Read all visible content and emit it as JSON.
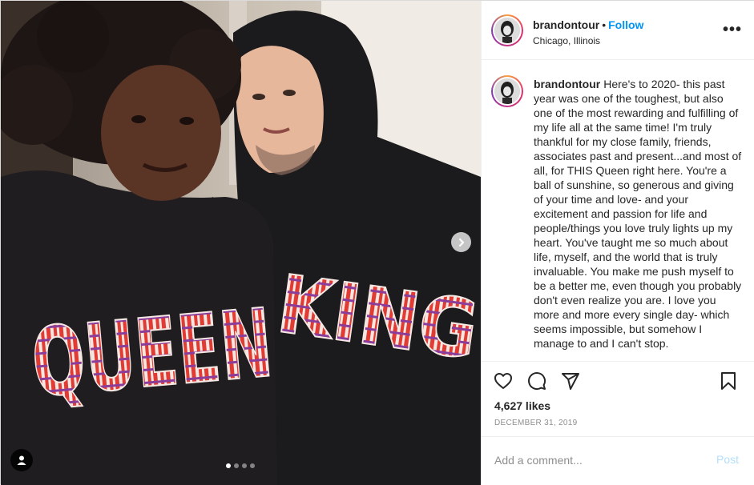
{
  "post": {
    "username": "brandontour",
    "separator": "•",
    "follow_label": "Follow",
    "location": "Chicago, Illinois",
    "more_label": "•••",
    "caption_user": "brandontour",
    "caption_text": "Here's to 2020- this past year was one of the toughest, but also one of the most rewarding and fulfilling of my life all at the same time! I'm truly thankful for my close family, friends, associates past and present...and most of all, for THIS Queen right here. You're a ball of sunshine, so generous and giving of your time and love- and your excitement and passion for life and people/things you love truly lights up my heart. You've taught me so much about life, myself, and the world that is truly invaluable. You make me push myself to be a better me, even though you probably don't even realize you are. I love you more and more every single day- which seems impossible, but somehow I manage to and I can't stop.",
    "likes": "4,627 likes",
    "date": "DECEMBER 31, 2019",
    "comment_placeholder": "Add a comment...",
    "post_label": "Post"
  },
  "media": {
    "shirt_left_text": "QUEEN",
    "shirt_right_text": "KING",
    "carousel_count": 4,
    "carousel_active": 0
  },
  "icons": [
    "heart-icon",
    "comment-icon",
    "share-icon",
    "bookmark-icon",
    "chevron-right-icon",
    "user-tag-icon"
  ],
  "colors": {
    "link": "#0095f6",
    "muted": "#8e8e8e",
    "post_disabled": "#b2dffc",
    "story_ring": [
      "#f9a03f",
      "#e1306c",
      "#833ab4"
    ]
  }
}
